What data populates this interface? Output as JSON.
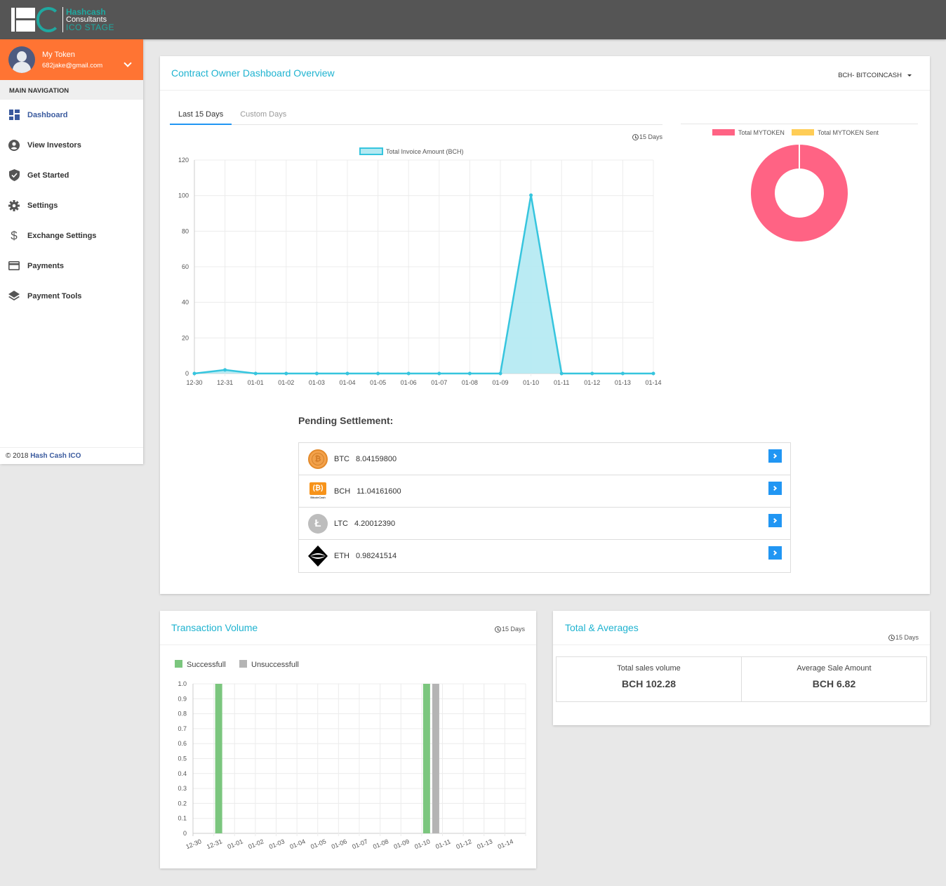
{
  "app": {
    "logo": {
      "line1": "Hashcash",
      "line2": "Consultants",
      "line3": "ICO STAGE"
    }
  },
  "user": {
    "name": "My Token",
    "email": "682jake@gmail.com"
  },
  "sidebar": {
    "header": "MAIN NAVIGATION",
    "items": [
      {
        "label": "Dashboard",
        "icon": "dashboard-icon",
        "active": true
      },
      {
        "label": "View Investors",
        "icon": "account-circle-icon"
      },
      {
        "label": "Get Started",
        "icon": "shield-check-icon"
      },
      {
        "label": "Settings",
        "icon": "gear-icon"
      },
      {
        "label": "Exchange Settings",
        "icon": "dollar-icon"
      },
      {
        "label": "Payments",
        "icon": "credit-card-icon"
      },
      {
        "label": "Payment Tools",
        "icon": "layers-icon"
      }
    ],
    "footer": {
      "prefix": "© 2018",
      "brand": "Hash Cash ICO"
    }
  },
  "overview": {
    "title": "Contract Owner Dashboard Overview",
    "coin_selector": "BCH- BITCOINCASH",
    "tabs": [
      {
        "label": "Last 15 Days",
        "active": true
      },
      {
        "label": "Custom Days",
        "active": false
      }
    ],
    "period_label": "15 Days"
  },
  "pending": {
    "title": "Pending Settlement:",
    "rows": [
      {
        "symbol": "BTC",
        "amount": "8.04159800",
        "icon": "bitcoin-icon"
      },
      {
        "symbol": "BCH",
        "amount": "11.04161600",
        "icon": "bitcoin-cash-icon"
      },
      {
        "symbol": "LTC",
        "amount": "4.20012390",
        "icon": "litecoin-icon"
      },
      {
        "symbol": "ETH",
        "amount": "0.98241514",
        "icon": "ethereum-icon"
      }
    ],
    "bch_caption": "BitcoinCash"
  },
  "transaction_volume": {
    "title": "Transaction Volume",
    "period_label": "15 Days"
  },
  "totals": {
    "title": "Total & Averages",
    "period_label": "15 Days",
    "boxes": [
      {
        "label": "Total sales volume",
        "value": "BCH 102.28"
      },
      {
        "label": "Average Sale Amount",
        "value": "BCH 6.82"
      }
    ]
  },
  "colors": {
    "topbar": "#555555",
    "user_panel": "#ff7433",
    "accent_title": "#1fb3d0",
    "brand_teal": "#1fa8a0",
    "button_blue": "#2196f3",
    "line": "#36c5de",
    "line_fill": "#b3e9f2",
    "donut_pink": "#ff6384",
    "donut_yellow": "#ffcd56",
    "bar_green": "#7bc67e",
    "bar_grey": "#b4b4b4"
  },
  "chart_data": [
    {
      "type": "line",
      "title": "",
      "legend": [
        "Total Invoice Amount (BCH)"
      ],
      "legend_position": "top",
      "categories": [
        "12-30",
        "12-31",
        "01-01",
        "01-02",
        "01-03",
        "01-04",
        "01-05",
        "01-06",
        "01-07",
        "01-08",
        "01-09",
        "01-10",
        "01-11",
        "01-12",
        "01-13",
        "01-14"
      ],
      "series": [
        {
          "name": "Total Invoice Amount (BCH)",
          "values": [
            0,
            2.0,
            0,
            0,
            0,
            0,
            0,
            0,
            0,
            0,
            0,
            100.28,
            0,
            0,
            0,
            0
          ]
        }
      ],
      "yticks": [
        0,
        20,
        40,
        60,
        80,
        100,
        120
      ],
      "ylim": [
        0,
        120
      ],
      "grid": true,
      "xlabel": "",
      "ylabel": ""
    },
    {
      "type": "pie",
      "variant": "doughnut",
      "legend_position": "top",
      "labels": [
        "Total MYTOKEN",
        "Total MYTOKEN Sent"
      ],
      "values": [
        100,
        0
      ]
    },
    {
      "type": "bar",
      "legend_position": "top-left",
      "categories": [
        "12-30",
        "12-31",
        "01-01",
        "01-02",
        "01-03",
        "01-04",
        "01-05",
        "01-06",
        "01-07",
        "01-08",
        "01-09",
        "01-10",
        "01-11",
        "01-12",
        "01-13",
        "01-14"
      ],
      "series": [
        {
          "name": "Successfull",
          "values": [
            0,
            1,
            0,
            0,
            0,
            0,
            0,
            0,
            0,
            0,
            0,
            1,
            0,
            0,
            0,
            0
          ]
        },
        {
          "name": "Unsuccessfull",
          "values": [
            0,
            0,
            0,
            0,
            0,
            0,
            0,
            0,
            0,
            0,
            0,
            1,
            0,
            0,
            0,
            0
          ]
        }
      ],
      "yticks": [
        "0",
        "0.1",
        "0.2",
        "0.3",
        "0.4",
        "0.5",
        "0.6",
        "0.7",
        "0.8",
        "0.9",
        "1.0"
      ],
      "ylim": [
        0,
        1.0
      ],
      "grid": true
    }
  ]
}
